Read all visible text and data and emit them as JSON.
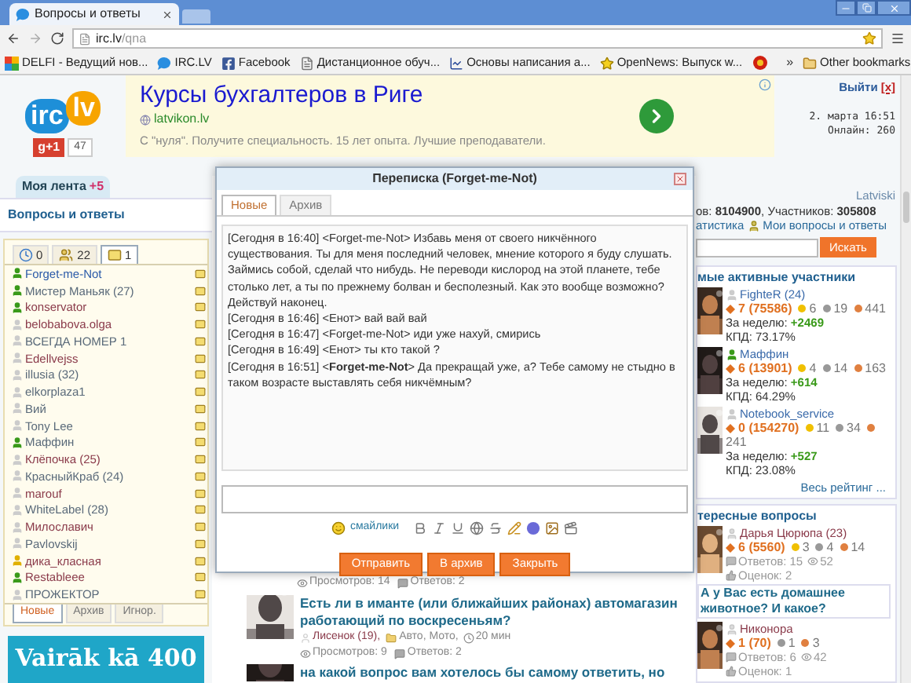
{
  "browser": {
    "tab_title": "Вопросы и ответы",
    "url_host": "irc.lv",
    "url_path": "/qna",
    "bookmarks": [
      {
        "kind": "delfi",
        "label": "DELFI - Ведущий нов..."
      },
      {
        "kind": "bubble",
        "label": "IRC.LV"
      },
      {
        "kind": "facebook",
        "label": "Facebook"
      },
      {
        "kind": "page",
        "label": "Дистанционное обуч..."
      },
      {
        "kind": "chart",
        "label": "Основы написания а..."
      },
      {
        "kind": "star",
        "label": "OpenNews: Выпуск w..."
      },
      {
        "kind": "emblem"
      }
    ],
    "more": "»",
    "other_bookmarks": "Other bookmarks"
  },
  "header": {
    "logo": {
      "left": "irc",
      "right": "lv"
    },
    "gplus": {
      "label": "g+1",
      "count": "47"
    },
    "ad": {
      "title": "Курсы бухгалтеров в Риге",
      "url": "latvikon.lv",
      "text": "С \"нуля\". Получите специальность. 15 лет опыта. Лучшие преподаватели."
    },
    "user": {
      "logout": "Выйти",
      "close": "[x]",
      "date": "2. марта 16:51",
      "online": "Онлайн: 260"
    }
  },
  "left": {
    "feed": {
      "label": "Моя лента",
      "badge": "+5"
    },
    "title": "Вопросы и ответы",
    "tabs": [
      {
        "kind": "clock",
        "label": "0",
        "selected": false
      },
      {
        "kind": "users",
        "label": "22",
        "selected": false
      },
      {
        "kind": "mail",
        "label": "1",
        "selected": true
      }
    ],
    "users": [
      {
        "name": {
          "text": "Forget-me-Not",
          "color": "#2a5aa8"
        },
        "icon": {
          "color": "#3a9a1a"
        }
      },
      {
        "name": {
          "text": "Мистер Маньяк (27)",
          "color": "#5a6a7a"
        },
        "icon": {
          "color": "#3a9a1a"
        }
      },
      {
        "name": {
          "text": "konservator",
          "color": "#8a3a4a"
        },
        "icon": {
          "color": "#3a9a1a"
        }
      },
      {
        "name": {
          "text": "belobabova.olga",
          "color": "#8a3a4a"
        },
        "icon": {
          "color": "#cccccc"
        }
      },
      {
        "name": {
          "text": "ВСЕГДА НОМЕР 1",
          "color": "#5a6a7a"
        },
        "icon": {
          "color": "#cccccc"
        }
      },
      {
        "name": {
          "text": "Edellvejss",
          "color": "#8a3a4a"
        },
        "icon": {
          "color": "#cccccc"
        }
      },
      {
        "name": {
          "text": "illusia (32)",
          "color": "#5a6a7a"
        },
        "icon": {
          "color": "#cccccc"
        }
      },
      {
        "name": {
          "text": "elkorplaza1",
          "color": "#5a6a7a"
        },
        "icon": {
          "color": "#cccccc"
        }
      },
      {
        "name": {
          "text": "Вий",
          "color": "#5a6a7a"
        },
        "icon": {
          "color": "#cccccc"
        }
      },
      {
        "name": {
          "text": "Tony Lee",
          "color": "#5a6a7a"
        },
        "icon": {
          "color": "#cccccc"
        }
      },
      {
        "name": {
          "text": "Маффин",
          "color": "#5a6a7a"
        },
        "icon": {
          "color": "#3a9a1a"
        }
      },
      {
        "name": {
          "text": "Клёпочка (25)",
          "color": "#8a3a4a"
        },
        "icon": {
          "color": "#cccccc"
        }
      },
      {
        "name": {
          "text": "КрасныйКраб (24)",
          "color": "#5a6a7a"
        },
        "icon": {
          "color": "#cccccc"
        }
      },
      {
        "name": {
          "text": "marouf",
          "color": "#8a3a4a"
        },
        "icon": {
          "color": "#cccccc"
        }
      },
      {
        "name": {
          "text": "WhiteLabel (28)",
          "color": "#5a6a7a"
        },
        "icon": {
          "color": "#cccccc"
        }
      },
      {
        "name": {
          "text": "Милославич",
          "color": "#8a3a4a"
        },
        "icon": {
          "color": "#cccccc"
        }
      },
      {
        "name": {
          "text": "Pavlovskij",
          "color": "#5a6a7a"
        },
        "icon": {
          "color": "#cccccc"
        }
      },
      {
        "name": {
          "text": "дика_класная",
          "color": "#8a3a4a"
        },
        "icon": {
          "color": "#e0b000"
        }
      },
      {
        "name": {
          "text": "Restableee",
          "color": "#8a3a4a"
        },
        "icon": {
          "color": "#3a9a1a"
        }
      },
      {
        "name": {
          "text": "ПРОЖЕКТОР",
          "color": "#5a6a7a"
        },
        "icon": {
          "color": "#cccccc"
        }
      }
    ],
    "bottom_tabs": [
      {
        "label": "Новые",
        "selected": true
      },
      {
        "label": "Архив",
        "selected": false
      },
      {
        "label": "Игнор.",
        "selected": false
      }
    ],
    "banner": "Vairāk kā 400"
  },
  "center": {
    "prev_views": "Просмотров: 14",
    "prev_answers": "Ответов: 2",
    "question": {
      "title": "Есть ли в иманте (или ближайших районах) автомагазин работающий по воскресеньям?",
      "author": "Лисенок (19),",
      "category": "Авто, Мото,",
      "time": "20 мин",
      "views": "Просмотров: 9",
      "answers": "Ответов: 2"
    },
    "next_title": "на какой вопрос вам хотелось бы самому ответить, но"
  },
  "right": {
    "language": "Latviski",
    "stats": "ов: **8104900**, Участников: **305808**",
    "links": [
      "атистика",
      "Мои вопросы и ответы"
    ],
    "search_button": "Искать",
    "active": {
      "title": "мые активные участники",
      "members": [
        {
          "name": "FighteR (24)",
          "icon": {
            "color": "#cccccc"
          },
          "level": "7",
          "points": "(75586)",
          "gold": "6",
          "silver": "19",
          "bronze": "441",
          "week_label": "За неделю:",
          "week": "+2469",
          "kpd": "КПД: 73.17%"
        },
        {
          "name": "Маффин",
          "icon": {
            "color": "#3a9a1a"
          },
          "level": "6",
          "points": "(13901)",
          "gold": "4",
          "silver": "14",
          "bronze": "163",
          "week_label": "За неделю:",
          "week": "+614",
          "kpd": "КПД: 64.29%"
        },
        {
          "name": "Notebook_service",
          "icon": {
            "color": "#cccccc"
          },
          "level": "0",
          "points": "(154270)",
          "gold": "11",
          "silver": "34",
          "bronze": "241",
          "week_label": "За неделю:",
          "week": "+527",
          "kpd": "КПД: 23.08%"
        }
      ],
      "more": "Весь рейтинг ..."
    },
    "interesting": {
      "title": "тересные вопросы",
      "items": [
        {
          "kind": "member",
          "name": "Дарья Цюрюпа (23)",
          "level": "6",
          "points": "(5560)",
          "gold": "3",
          "silver": "4",
          "bronze": "14",
          "answers": "Ответов: 15",
          "views": "52",
          "ratings": "Оценок: 2"
        },
        {
          "kind": "question",
          "title": "А у Вас есть домашнее животное? И какое?"
        },
        {
          "kind": "member",
          "name": "Никонора",
          "level": "1",
          "points": "(70)",
          "silver": "1",
          "bronze": "3",
          "answers": "Ответов: 6",
          "views": "42",
          "ratings": "Оценок: 1"
        }
      ]
    }
  },
  "dialog": {
    "title": "Переписка (Forget-me-Not)",
    "tabs": [
      {
        "label": "Новые",
        "selected": true
      },
      {
        "label": "Архив",
        "selected": false
      }
    ],
    "messages": [
      "[Сегодня в 16:40] <Forget-me-Not> Избавь меня от своего никчённого существования. Ты для меня последний человек, мнение которого я буду слушать. Займись собой, сделай что нибудь. Не переводи кислород на этой планете, тебе столько лет, а ты по прежнему болван и бесполезный. Как это вообще возможно? Действуй наконец.",
      "[Сегодня в 16:46] <Енот> вай вай вай",
      "[Сегодня в 16:47] <Forget-me-Not> иди уже нахуй, смирись",
      "[Сегодня в 16:49] <Енот> ты кто такой ?",
      "[Сегодня в 16:51] <**Forget-me-Not**> Да прекращай уже, а? Тебе самому не стыдно в таком возрасте выставлять себя никчёмным?"
    ],
    "smileys": "смайлики",
    "tools": [
      {
        "kind": "bold"
      },
      {
        "kind": "italic"
      },
      {
        "kind": "underline"
      },
      {
        "kind": "globe"
      },
      {
        "kind": "strike"
      },
      {
        "kind": "note"
      },
      {
        "kind": "ball"
      },
      {
        "kind": "portrait"
      },
      {
        "kind": "film"
      }
    ],
    "buttons": [
      "Отправить",
      "В архив",
      "Закрыть"
    ]
  }
}
